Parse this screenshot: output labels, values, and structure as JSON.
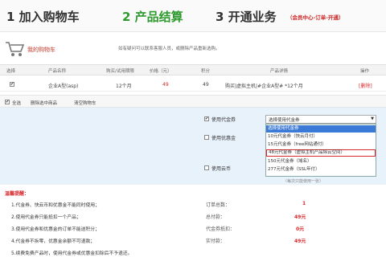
{
  "steps": [
    {
      "label": "1 加入购物车"
    },
    {
      "label": "2 产品结算"
    },
    {
      "label": "3 开通业务"
    }
  ],
  "steps_sub": "（会员中心-订单-开通）",
  "cart": {
    "title": "我的购物车",
    "note": "如有疑问可以联系客服人员，或删除产品重新选购。"
  },
  "table": {
    "headers": [
      "选择",
      "产品名称",
      "购买/试用期限",
      "价格（元）",
      "积分",
      "产品详情",
      "操作"
    ],
    "row": {
      "name": "企业A型(asp)",
      "period": "12个月",
      "price": "49",
      "points": "49",
      "detail": "购买|虚拟主机|#企业A型# *12个月",
      "op": "[删除]"
    }
  },
  "actions": {
    "select_all": "全选",
    "delete_selected": "删除选中商品",
    "clear_cart": "清空购物车"
  },
  "payment": {
    "voucher_label": "使用代金券",
    "preferential_label": "使用优惠金",
    "cloud_label": "使用云币",
    "select_value": "选择使用代金券",
    "options": [
      "选择使用代金券",
      "10元代金券（快云月付）",
      "15元代金券（free网站通付）",
      "48元代金券（虚拟主机产品除云空间）",
      "150元代金券（域名）",
      "277元代金券（SSL年付）"
    ],
    "hint": "（每次只能使用一张）"
  },
  "warnings": {
    "title": "温馨提醒：",
    "items": [
      "1.代金券、快云币和优惠金不能同时使用；",
      "2.使用代金券只能抵扣一个产品；",
      "3.使用代金券和优惠金的订单不能送积分；",
      "4.代金券不拆零，优惠金余额不可退款；",
      "5.续费免费产品时，使用代金券或优惠金扣除后不予退还。"
    ]
  },
  "summary": [
    {
      "label": "订单总数：",
      "value": "1"
    },
    {
      "label": "总付款：",
      "value": "49元"
    },
    {
      "label": "代金券抵扣：",
      "value": "0元"
    },
    {
      "label": "实付款：",
      "value": "49元"
    }
  ],
  "colors": {
    "active_step": "#2e9a2e",
    "accent_red": "#d9262a",
    "highlight_blue": "#3b79d6",
    "panel_blue": "#e8f2fb"
  }
}
